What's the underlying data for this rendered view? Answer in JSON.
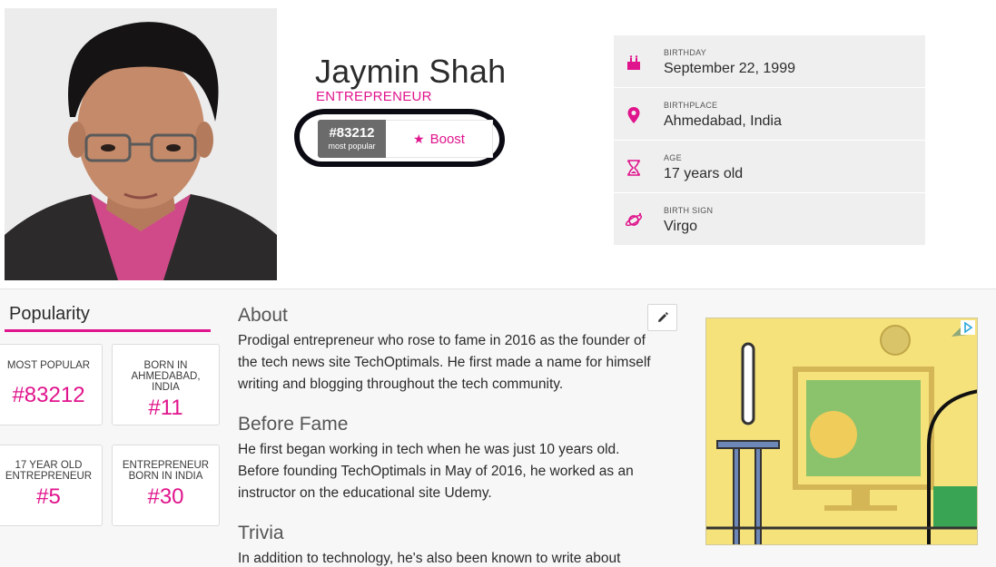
{
  "profile": {
    "name": "Jaymin Shah",
    "role": "ENTREPRENEUR",
    "rank_value": "#83212",
    "rank_sub": "most popular",
    "boost_label": "Boost"
  },
  "facts": [
    {
      "label": "BIRTHDAY",
      "value": "September 22, 1999",
      "icon": "cake-icon"
    },
    {
      "label": "BIRTHPLACE",
      "value": "Ahmedabad, India",
      "icon": "location-pin-icon"
    },
    {
      "label": "AGE",
      "value": "17 years old",
      "icon": "hourglass-icon"
    },
    {
      "label": "BIRTH SIGN",
      "value": "Virgo",
      "icon": "planet-icon"
    }
  ],
  "popularity": {
    "title": "Popularity",
    "cards": [
      {
        "label": "MOST POPULAR",
        "value": "#83212"
      },
      {
        "label": "BORN IN AHMEDABAD, INDIA",
        "value": "#11"
      },
      {
        "label": "17 YEAR OLD ENTREPRENEUR",
        "value": "#5"
      },
      {
        "label": "ENTREPRENEUR BORN IN INDIA",
        "value": "#30"
      }
    ]
  },
  "about": {
    "heading": "About",
    "text": "Prodigal entrepreneur who rose to fame in 2016 as the founder of the tech news site TechOptimals. He first made a name for himself writing and blogging throughout the tech community."
  },
  "before_fame": {
    "heading": "Before Fame",
    "text": "He first began working in tech when he was just 10 years old. Before founding TechOptimals in May of 2016, he worked as an instructor on the educational site Udemy."
  },
  "trivia": {
    "heading": "Trivia",
    "text": "In addition to technology, he's also been known to write about"
  },
  "colors": {
    "accent": "#e0148c",
    "fact_bg": "#efefef",
    "ad_bg": "#f6e27a"
  }
}
